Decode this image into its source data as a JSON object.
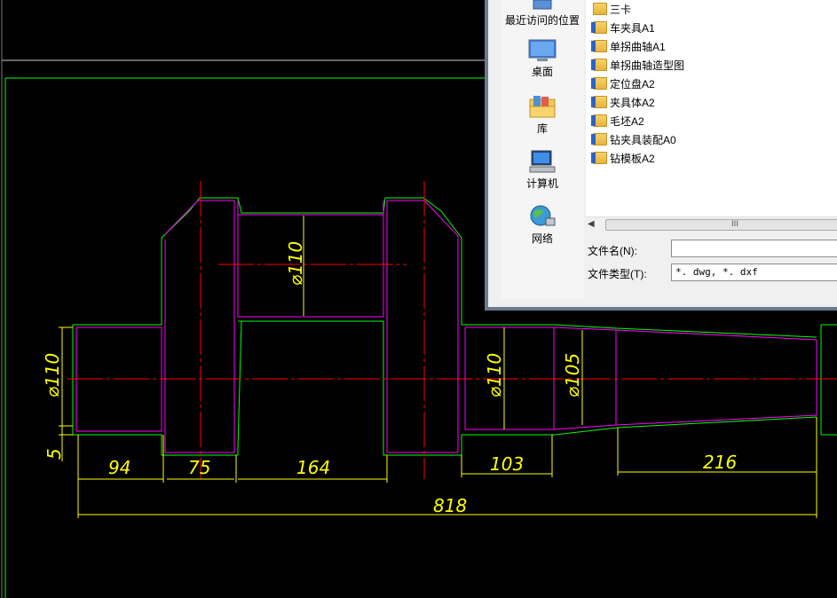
{
  "drawing": {
    "dimensions": {
      "d110_crank": "⌀110",
      "d110_left": "⌀110",
      "d110_right": "⌀110",
      "d105": "⌀105",
      "d5": "5",
      "l94": "94",
      "l75": "75",
      "l164": "164",
      "l103": "103",
      "l216": "216",
      "l818": "818"
    },
    "colors": {
      "outline": "#00ff00",
      "profile": "#ff00ff",
      "center": "#ff0000",
      "dimension": "#ffff00",
      "background": "#000000"
    }
  },
  "dialog": {
    "places": [
      {
        "label": "最近访问的位置",
        "icon": "recent-places-icon"
      },
      {
        "label": "桌面",
        "icon": "desktop-icon"
      },
      {
        "label": "库",
        "icon": "library-icon"
      },
      {
        "label": "计算机",
        "icon": "computer-icon"
      },
      {
        "label": "网络",
        "icon": "network-icon"
      }
    ],
    "files": [
      {
        "name": "三卡",
        "type": "folder"
      },
      {
        "name": "车夹具A1",
        "type": "dwg"
      },
      {
        "name": "单拐曲轴A1",
        "type": "dwg"
      },
      {
        "name": "单拐曲轴造型图",
        "type": "dwg"
      },
      {
        "name": "定位盘A2",
        "type": "dwg"
      },
      {
        "name": "夹具体A2",
        "type": "dwg"
      },
      {
        "name": "毛坯A2",
        "type": "dwg"
      },
      {
        "name": "钻夹具装配A0",
        "type": "dwg"
      },
      {
        "name": "钻模板A2",
        "type": "dwg"
      }
    ],
    "scroll_thumb": "III",
    "filename_label": "文件名(N):",
    "filename_value": "",
    "filetype_label": "文件类型(T):",
    "filetype_value": "*. dwg, *. dxf"
  }
}
